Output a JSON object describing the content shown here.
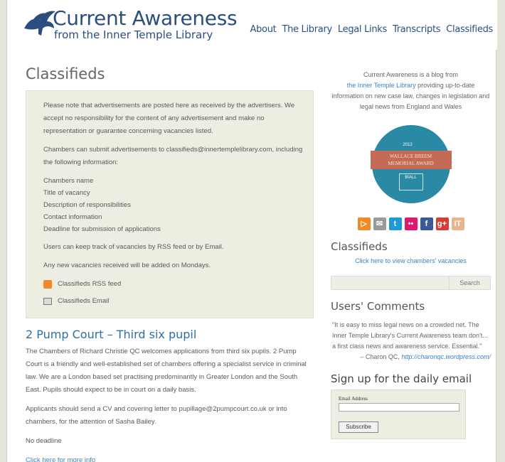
{
  "site": {
    "title": "Current Awareness",
    "subtitle": "from the Inner Temple Library"
  },
  "nav": [
    "About",
    "The Library",
    "Legal Links",
    "Transcripts",
    "Classifieds"
  ],
  "page": {
    "title": "Classifieds",
    "notice": {
      "p1": "Please note that advertisements are posted here as received by the advertisers. We accept no responsibility for the content of any advertisement and make no representation or guarantee concerning vacancies listed.",
      "p2": "Chambers can submit advertisements to classifieds@innertemplelibrary.com, including the following information:",
      "list": [
        "Chambers name",
        "Title of vacancy",
        "Description of responsibilities",
        "Contact information",
        "Deadline for submission of applications"
      ],
      "p3": "Users can keep track of vacancies by RSS feed or by Email.",
      "p4": "Any new vacancies received will be added on Mondays.",
      "rss_label": "Classifieds RSS feed",
      "email_label": "Classifieds Email"
    },
    "post": {
      "title": "2 Pump Court – Third six pupil",
      "p1": "The Chambers of Richard Christie QC welcomes applications from third six pupils. 2 Pump Court is a friendly and well-established set of chambers offering a specialist service in criminal law. We are a London based set practising predominantly in Greater London and the South East. Pupils should expect to be in court on a daily basis.",
      "p2": "Applicants should send a CV and covering letter to pupillage@2pumpcourt.co.uk or into chambers, for the attention of Sasha Bailey.",
      "p3": "No deadline",
      "more": "Click here for more info"
    }
  },
  "sidebar": {
    "blurb_1": "Current Awareness is a blog from",
    "blurb_link": "the Inner Temple Library",
    "blurb_2": "providing up-to-date information on new case law, changes in legislation and legal news from England and Wales",
    "badge": {
      "year": "2012",
      "line1": "WALLACE BREEM",
      "line2": "MEMORIAL AWARD",
      "org": "BIALL"
    },
    "social": [
      {
        "icon": "rss-icon",
        "glyph": "▷",
        "color": "#f08a24"
      },
      {
        "icon": "email-icon",
        "glyph": "✉",
        "color": "#9a9a9a"
      },
      {
        "icon": "twitter-icon",
        "glyph": "t",
        "color": "#1d9bd8"
      },
      {
        "icon": "flickr-icon",
        "glyph": "••",
        "color": "#e0186b"
      },
      {
        "icon": "facebook-icon",
        "glyph": "f",
        "color": "#3b5998"
      },
      {
        "icon": "googleplus-icon",
        "glyph": "g+",
        "color": "#d73d32"
      },
      {
        "icon": "it-icon",
        "glyph": "IT",
        "color": "#e9b48d"
      }
    ],
    "classifieds_heading": "Classifieds",
    "classifieds_link": "Click here to view chambers' vacancies",
    "search_button": "Search",
    "comments_heading": "Users' Comments",
    "quote": "\"It is easy to miss legal news on a crowded net. The Inner Temple Library's Current Awareness team don't... a first class news and awareness service. Essential.\"",
    "quote_author": "– Charon QC,",
    "quote_url": "http://charonqc.wordpress.com/",
    "signup_heading": "Sign up for the daily email",
    "email_label": "Email Address",
    "subscribe": "Subscribe"
  }
}
